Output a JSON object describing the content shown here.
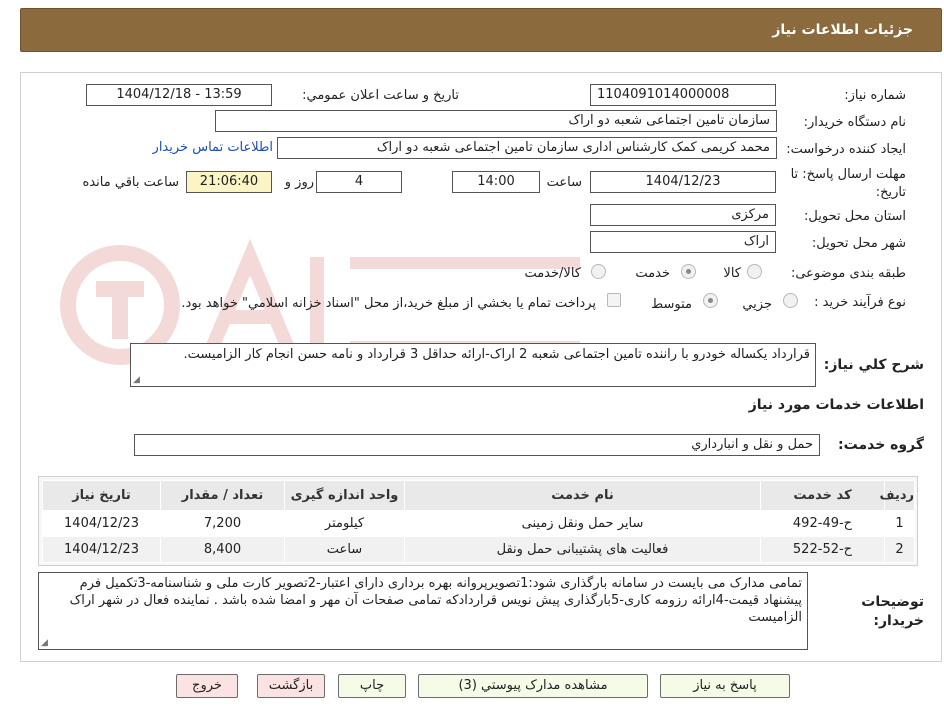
{
  "header": {
    "title": "جزئیات اطلاعات نیاز"
  },
  "fields": {
    "need_number_label": "شماره نیاز:",
    "need_number": "1104091014000008",
    "announce_datetime_label": "تاریخ و ساعت اعلان عمومي:",
    "announce_datetime": "1404/12/18 - 13:59",
    "buyer_org_label": "نام دستگاه خريدار:",
    "buyer_org": "سازمان تامین اجتماعی شعبه دو اراک",
    "requester_label": "ايجاد کننده درخواست:",
    "requester": "محمد کریمی کمک کارشناس اداری سازمان تامین اجتماعی شعبه دو اراک",
    "buyer_contact_link": "اطلاعات تماس خريدار",
    "deadline_label_line1": "مهلت ارسال پاسخ: تا",
    "deadline_label_line2": "تاريخ:",
    "deadline_date": "1404/12/23",
    "deadline_time_label": "ساعت",
    "deadline_time": "14:00",
    "days_remaining": "4",
    "days_label": "روز و",
    "time_remaining": "21:06:40",
    "time_remaining_label": "ساعت باقي مانده",
    "province_label": "استان محل تحويل:",
    "province": "مرکزی",
    "city_label": "شهر محل تحويل:",
    "city": "اراک",
    "category_label": "طبقه بندی موضوعی:",
    "category_options": {
      "goods": "کالا",
      "service": "خدمت",
      "goods_service": "کالا/خدمت"
    },
    "category_selected": "service",
    "process_label": "نوع فرآيند خريد :",
    "process_options": {
      "partial": "جزيي",
      "medium": "متوسط"
    },
    "process_selected": "medium",
    "treasury_note": "پرداخت تمام يا بخشي از مبلغ خريد،از محل \"اسناد خزانه اسلامي\" خواهد بود."
  },
  "description": {
    "label": "شرح کلي نياز:",
    "text": "قرارداد یکساله خودرو با راننده تامین اجتماعی شعبه 2 اراک-ارائه حداقل 3 قرارداد و نامه حسن انجام کار الزامیست."
  },
  "services": {
    "section_title": "اطلاعات خدمات مورد نياز",
    "group_label": "گروه خدمت:",
    "group_value": "حمل و نقل و انبارداري",
    "table": {
      "headers": [
        "رديف",
        "کد خدمت",
        "نام خدمت",
        "واحد اندازه گيری",
        "تعداد / مقدار",
        "تاريخ نياز"
      ],
      "rows": [
        [
          "1",
          "ح-49-492",
          "سایر حمل ونقل زمینی",
          "کیلومتر",
          "7,200",
          "1404/12/23"
        ],
        [
          "2",
          "ح-52-522",
          "فعالیت های پشتیبانی حمل ونقل",
          "ساعت",
          "8,400",
          "1404/12/23"
        ]
      ]
    }
  },
  "buyer_notes": {
    "label_line1": "توضيحات",
    "label_line2": "خريدار:",
    "text": "تمامی مدارک می بایست در سامانه بارگذاری شود:1تصویرپروانه بهره برداری دارای اعتبار-2تصویر کارت ملی و شناسنامه-3تکمیل فرم پیشنهاد قیمت-4ارائه رزومه کاری-5بارگذاری پیش نویس قراردادکه تمامی صفحات آن مهر و امضا شده باشد . نماینده فعال در شهر اراک الزامیست"
  },
  "buttons": {
    "reply": "پاسخ به نياز",
    "attachments": "مشاهده مدارک پيوستي (3)",
    "print": "چاپ",
    "back": "بازگشت",
    "exit": "خروج"
  },
  "colors": {
    "header_bg": "#8b6b3e",
    "link": "#1a4fb5",
    "highlight_box": "#fbf5c6",
    "button_green": "#f4fbe6",
    "button_pink": "#fbe3e3"
  }
}
